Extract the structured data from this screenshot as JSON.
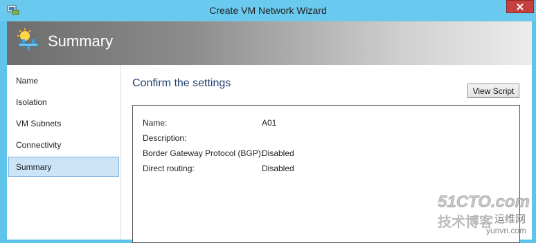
{
  "window": {
    "title": "Create VM Network Wizard",
    "titlebar_color": "#6ac9ee",
    "close_button_color": "#c74040"
  },
  "header": {
    "title": "Summary",
    "icon": "network-wizard-icon"
  },
  "sidebar": {
    "items": [
      {
        "label": "Name",
        "selected": false
      },
      {
        "label": "Isolation",
        "selected": false
      },
      {
        "label": "VM Subnets",
        "selected": false
      },
      {
        "label": "Connectivity",
        "selected": false
      },
      {
        "label": "Summary",
        "selected": true
      }
    ],
    "selected_color": "#cce4f7"
  },
  "main": {
    "heading": "Confirm the settings",
    "view_script_label": "View Script",
    "settings": [
      {
        "label": "Name:",
        "value": "A01"
      },
      {
        "label": "Description:",
        "value": ""
      },
      {
        "label": "Border Gateway Protocol (BGP):",
        "value": "Disabled"
      },
      {
        "label": "Direct routing:",
        "value": "Disabled"
      }
    ]
  },
  "watermark": {
    "line1": "51CTO.com",
    "line2": "技术博客",
    "line3": "运维网",
    "line4": "yunvn.com"
  }
}
